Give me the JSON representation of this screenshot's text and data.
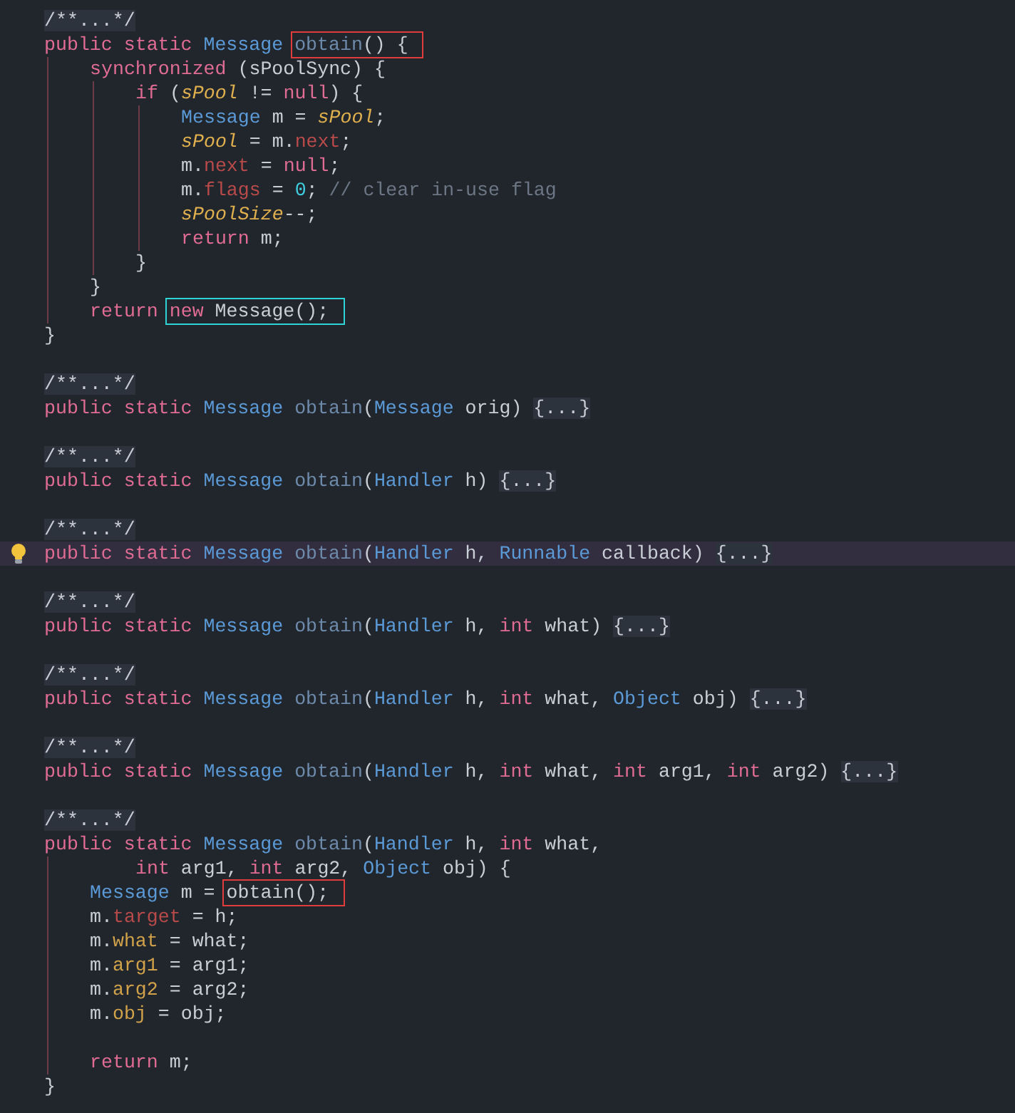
{
  "editor": {
    "lines": [
      {
        "highlighted": false,
        "bulb": false,
        "tokens": [
          {
            "text": "/**...*/",
            "kind": "fold"
          }
        ]
      },
      {
        "highlighted": false,
        "bulb": false,
        "tokens": [
          {
            "text": "public static ",
            "kind": "kw"
          },
          {
            "text": "Message ",
            "kind": "type"
          },
          {
            "kind": "box",
            "color": "#e03c3c",
            "tokens": [
              {
                "text": "obtain",
                "kind": "method"
              },
              {
                "text": "() {",
                "kind": "plain"
              }
            ]
          }
        ],
        "children": [
          {
            "highlighted": false,
            "bulb": false,
            "tokens": [
              {
                "text": "synchronized",
                "kind": "kw"
              },
              {
                "text": " (sPoolSync) {",
                "kind": "plain"
              }
            ],
            "children": [
              {
                "highlighted": false,
                "bulb": false,
                "tokens": [
                  {
                    "text": "if",
                    "kind": "kw"
                  },
                  {
                    "text": " (",
                    "kind": "plain"
                  },
                  {
                    "text": "sPool",
                    "kind": "static"
                  },
                  {
                    "text": " != ",
                    "kind": "plain"
                  },
                  {
                    "text": "null",
                    "kind": "kw"
                  },
                  {
                    "text": ") {",
                    "kind": "plain"
                  }
                ],
                "children": [
                  {
                    "highlighted": false,
                    "bulb": false,
                    "tokens": [
                      {
                        "text": "Message",
                        "kind": "type"
                      },
                      {
                        "text": " m = ",
                        "kind": "plain"
                      },
                      {
                        "text": "sPool",
                        "kind": "static"
                      },
                      {
                        "text": ";",
                        "kind": "plain"
                      }
                    ]
                  },
                  {
                    "highlighted": false,
                    "bulb": false,
                    "tokens": [
                      {
                        "text": "sPool",
                        "kind": "static"
                      },
                      {
                        "text": " = m.",
                        "kind": "plain"
                      },
                      {
                        "text": "next",
                        "kind": "field"
                      },
                      {
                        "text": ";",
                        "kind": "plain"
                      }
                    ]
                  },
                  {
                    "highlighted": false,
                    "bulb": false,
                    "tokens": [
                      {
                        "text": "m.",
                        "kind": "plain"
                      },
                      {
                        "text": "next",
                        "kind": "field"
                      },
                      {
                        "text": " = ",
                        "kind": "plain"
                      },
                      {
                        "text": "null",
                        "kind": "kw"
                      },
                      {
                        "text": ";",
                        "kind": "plain"
                      }
                    ]
                  },
                  {
                    "highlighted": false,
                    "bulb": false,
                    "tokens": [
                      {
                        "text": "m.",
                        "kind": "plain"
                      },
                      {
                        "text": "flags",
                        "kind": "field"
                      },
                      {
                        "text": " = ",
                        "kind": "plain"
                      },
                      {
                        "text": "0",
                        "kind": "num"
                      },
                      {
                        "text": "; ",
                        "kind": "plain"
                      },
                      {
                        "text": "// clear in-use flag",
                        "kind": "comment"
                      }
                    ]
                  },
                  {
                    "highlighted": false,
                    "bulb": false,
                    "tokens": [
                      {
                        "text": "sPoolSize",
                        "kind": "static"
                      },
                      {
                        "text": "--;",
                        "kind": "plain"
                      }
                    ]
                  },
                  {
                    "highlighted": false,
                    "bulb": false,
                    "tokens": [
                      {
                        "text": "return",
                        "kind": "kw"
                      },
                      {
                        "text": " m;",
                        "kind": "plain"
                      }
                    ]
                  }
                ]
              },
              {
                "highlighted": false,
                "bulb": false,
                "tokens": [
                  {
                    "text": "}",
                    "kind": "plain"
                  }
                ]
              }
            ]
          },
          {
            "highlighted": false,
            "bulb": false,
            "tokens": [
              {
                "text": "}",
                "kind": "plain"
              }
            ]
          },
          {
            "highlighted": false,
            "bulb": false,
            "tokens": [
              {
                "text": "return ",
                "kind": "kw"
              },
              {
                "kind": "box",
                "color": "#2ed3d6",
                "tokens": [
                  {
                    "text": "new",
                    "kind": "kw"
                  },
                  {
                    "text": " Message();",
                    "kind": "plain"
                  }
                ]
              }
            ]
          }
        ]
      },
      {
        "highlighted": false,
        "bulb": false,
        "tokens": [
          {
            "text": "}",
            "kind": "plain"
          }
        ]
      },
      {
        "highlighted": false,
        "bulb": false
      },
      {
        "highlighted": false,
        "bulb": false,
        "tokens": [
          {
            "text": "/**...*/",
            "kind": "fold"
          }
        ]
      },
      {
        "highlighted": false,
        "bulb": false,
        "tokens": [
          {
            "text": "public static ",
            "kind": "kw"
          },
          {
            "text": "Message ",
            "kind": "type"
          },
          {
            "text": "obtain",
            "kind": "method"
          },
          {
            "text": "(",
            "kind": "plain"
          },
          {
            "text": "Message",
            "kind": "type"
          },
          {
            "text": " orig) ",
            "kind": "plain"
          },
          {
            "text": "{...}",
            "kind": "fold"
          }
        ]
      },
      {
        "highlighted": false,
        "bulb": false
      },
      {
        "highlighted": false,
        "bulb": false,
        "tokens": [
          {
            "text": "/**...*/",
            "kind": "fold"
          }
        ]
      },
      {
        "highlighted": false,
        "bulb": false,
        "tokens": [
          {
            "text": "public static ",
            "kind": "kw"
          },
          {
            "text": "Message ",
            "kind": "type"
          },
          {
            "text": "obtain",
            "kind": "method"
          },
          {
            "text": "(",
            "kind": "plain"
          },
          {
            "text": "Handler",
            "kind": "type"
          },
          {
            "text": " h) ",
            "kind": "plain"
          },
          {
            "text": "{...}",
            "kind": "fold"
          }
        ]
      },
      {
        "highlighted": false,
        "bulb": false
      },
      {
        "highlighted": false,
        "bulb": false,
        "tokens": [
          {
            "text": "/**...*/",
            "kind": "fold"
          }
        ]
      },
      {
        "highlighted": true,
        "bulb": true,
        "tokens": [
          {
            "text": "public static ",
            "kind": "kw"
          },
          {
            "text": "Message ",
            "kind": "type"
          },
          {
            "text": "obtain",
            "kind": "method"
          },
          {
            "text": "(",
            "kind": "plain"
          },
          {
            "text": "Handler",
            "kind": "type"
          },
          {
            "text": " h, ",
            "kind": "plain"
          },
          {
            "text": "Runnable",
            "kind": "type"
          },
          {
            "text": " callback) ",
            "kind": "plain"
          },
          {
            "text": "{...}",
            "kind": "fold"
          }
        ]
      },
      {
        "highlighted": false,
        "bulb": false
      },
      {
        "highlighted": false,
        "bulb": false,
        "tokens": [
          {
            "text": "/**...*/",
            "kind": "fold"
          }
        ]
      },
      {
        "highlighted": false,
        "bulb": false,
        "tokens": [
          {
            "text": "public static ",
            "kind": "kw"
          },
          {
            "text": "Message ",
            "kind": "type"
          },
          {
            "text": "obtain",
            "kind": "method"
          },
          {
            "text": "(",
            "kind": "plain"
          },
          {
            "text": "Handler",
            "kind": "type"
          },
          {
            "text": " h, ",
            "kind": "plain"
          },
          {
            "text": "int",
            "kind": "kw"
          },
          {
            "text": " what) ",
            "kind": "plain"
          },
          {
            "text": "{...}",
            "kind": "fold"
          }
        ]
      },
      {
        "highlighted": false,
        "bulb": false
      },
      {
        "highlighted": false,
        "bulb": false,
        "tokens": [
          {
            "text": "/**...*/",
            "kind": "fold"
          }
        ]
      },
      {
        "highlighted": false,
        "bulb": false,
        "tokens": [
          {
            "text": "public static ",
            "kind": "kw"
          },
          {
            "text": "Message ",
            "kind": "type"
          },
          {
            "text": "obtain",
            "kind": "method"
          },
          {
            "text": "(",
            "kind": "plain"
          },
          {
            "text": "Handler",
            "kind": "type"
          },
          {
            "text": " h, ",
            "kind": "plain"
          },
          {
            "text": "int",
            "kind": "kw"
          },
          {
            "text": " what, ",
            "kind": "plain"
          },
          {
            "text": "Object",
            "kind": "type"
          },
          {
            "text": " obj) ",
            "kind": "plain"
          },
          {
            "text": "{...}",
            "kind": "fold"
          }
        ]
      },
      {
        "highlighted": false,
        "bulb": false
      },
      {
        "highlighted": false,
        "bulb": false,
        "tokens": [
          {
            "text": "/**...*/",
            "kind": "fold"
          }
        ]
      },
      {
        "highlighted": false,
        "bulb": false,
        "tokens": [
          {
            "text": "public static ",
            "kind": "kw"
          },
          {
            "text": "Message ",
            "kind": "type"
          },
          {
            "text": "obtain",
            "kind": "method"
          },
          {
            "text": "(",
            "kind": "plain"
          },
          {
            "text": "Handler",
            "kind": "type"
          },
          {
            "text": " h, ",
            "kind": "plain"
          },
          {
            "text": "int",
            "kind": "kw"
          },
          {
            "text": " what, ",
            "kind": "plain"
          },
          {
            "text": "int",
            "kind": "kw"
          },
          {
            "text": " arg1, ",
            "kind": "plain"
          },
          {
            "text": "int",
            "kind": "kw"
          },
          {
            "text": " arg2) ",
            "kind": "plain"
          },
          {
            "text": "{...}",
            "kind": "fold"
          }
        ]
      },
      {
        "highlighted": false,
        "bulb": false
      },
      {
        "highlighted": false,
        "bulb": false,
        "tokens": [
          {
            "text": "/**...*/",
            "kind": "fold"
          }
        ]
      },
      {
        "highlighted": false,
        "bulb": false,
        "tokens": [
          {
            "text": "public static ",
            "kind": "kw"
          },
          {
            "text": "Message ",
            "kind": "type"
          },
          {
            "text": "obtain",
            "kind": "method"
          },
          {
            "text": "(",
            "kind": "plain"
          },
          {
            "text": "Handler",
            "kind": "type"
          },
          {
            "text": " h, ",
            "kind": "plain"
          },
          {
            "text": "int",
            "kind": "kw"
          },
          {
            "text": " what,",
            "kind": "plain"
          }
        ],
        "continuation": [
          {
            "text": "int",
            "kind": "kw"
          },
          {
            "text": " arg1, ",
            "kind": "plain"
          },
          {
            "text": "int",
            "kind": "kw"
          },
          {
            "text": " arg2, ",
            "kind": "plain"
          },
          {
            "text": "Object",
            "kind": "type"
          },
          {
            "text": " obj) {",
            "kind": "plain"
          }
        ],
        "children": [
          {
            "highlighted": false,
            "bulb": false,
            "tokens": [
              {
                "text": "Message",
                "kind": "type"
              },
              {
                "text": " m = ",
                "kind": "plain"
              },
              {
                "kind": "box",
                "color": "#e03c3c",
                "tokens": [
                  {
                    "text": "obtain();",
                    "kind": "plain"
                  }
                ]
              }
            ]
          },
          {
            "highlighted": false,
            "bulb": false,
            "tokens": [
              {
                "text": "m.",
                "kind": "plain"
              },
              {
                "text": "target",
                "kind": "field"
              },
              {
                "text": " = h;",
                "kind": "plain"
              }
            ]
          },
          {
            "highlighted": false,
            "bulb": false,
            "tokens": [
              {
                "text": "m.",
                "kind": "plain"
              },
              {
                "text": "what",
                "kind": "field2"
              },
              {
                "text": " = what;",
                "kind": "plain"
              }
            ]
          },
          {
            "highlighted": false,
            "bulb": false,
            "tokens": [
              {
                "text": "m.",
                "kind": "plain"
              },
              {
                "text": "arg1",
                "kind": "field2"
              },
              {
                "text": " = arg1;",
                "kind": "plain"
              }
            ]
          },
          {
            "highlighted": false,
            "bulb": false,
            "tokens": [
              {
                "text": "m.",
                "kind": "plain"
              },
              {
                "text": "arg2",
                "kind": "field2"
              },
              {
                "text": " = arg2;",
                "kind": "plain"
              }
            ]
          },
          {
            "highlighted": false,
            "bulb": false,
            "tokens": [
              {
                "text": "m.",
                "kind": "plain"
              },
              {
                "text": "obj",
                "kind": "field2"
              },
              {
                "text": " = obj;",
                "kind": "plain"
              }
            ]
          },
          {
            "highlighted": false,
            "bulb": false
          },
          {
            "highlighted": false,
            "bulb": false,
            "tokens": [
              {
                "text": "return",
                "kind": "kw"
              },
              {
                "text": " m;",
                "kind": "plain"
              }
            ]
          }
        ]
      },
      {
        "highlighted": false,
        "bulb": false,
        "tokens": [
          {
            "text": "}",
            "kind": "plain"
          }
        ]
      }
    ]
  }
}
